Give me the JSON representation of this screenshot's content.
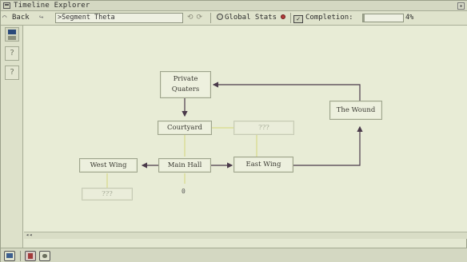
{
  "window": {
    "title": "Timeline Explorer",
    "close_glyph": "×"
  },
  "toolbar": {
    "back_label": "Back",
    "path_value": ">Segment Theta",
    "global_stats_label": "Global Stats",
    "completion_label": "Completion:",
    "completion_percent_text": "4%",
    "completion_fraction": 0.04
  },
  "sidebar": {
    "help_glyph": "?"
  },
  "graph": {
    "nodes": [
      {
        "id": "private-quarters",
        "label": "Private\nQuaters",
        "known": true
      },
      {
        "id": "courtyard",
        "label": "Courtyard",
        "known": true
      },
      {
        "id": "unknown-a",
        "label": "???",
        "known": false
      },
      {
        "id": "the-wound",
        "label": "The Wound",
        "known": true
      },
      {
        "id": "west-wing",
        "label": "West Wing",
        "known": true
      },
      {
        "id": "main-hall",
        "label": "Main Hall",
        "known": true
      },
      {
        "id": "east-wing",
        "label": "East Wing",
        "known": true
      },
      {
        "id": "unknown-b",
        "label": "???",
        "known": false
      }
    ],
    "main_hall_counter": "0"
  },
  "scroll": {
    "left_glyph": "◂◂"
  },
  "colors": {
    "background": "#e8ecd6",
    "node_border": "#9ea48d",
    "link_yellow": "#d8da8a",
    "link_dark": "#4a3a4a",
    "alert_dot": "#b33a3a"
  }
}
